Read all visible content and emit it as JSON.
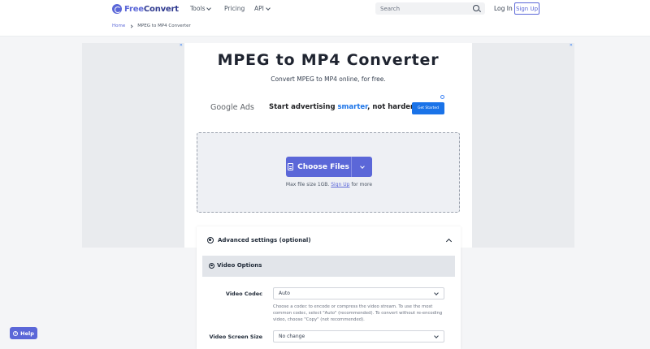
{
  "header": {
    "logo": {
      "part1": "Free",
      "part2": "Convert"
    },
    "nav": [
      {
        "label": "Tools",
        "has_dropdown": true
      },
      {
        "label": "Pricing",
        "has_dropdown": false
      },
      {
        "label": "API",
        "has_dropdown": true
      }
    ],
    "search": {
      "placeholder": "Search",
      "icon": "search-icon"
    },
    "login_label": "Log In",
    "signup_label": "Sign Up"
  },
  "breadcrumb": {
    "home": "Home",
    "current": "MPEG to MP4 Converter"
  },
  "main": {
    "title": "MPEG to MP4 Converter",
    "subtitle": "Convert MPEG to MP4 online, for free."
  },
  "ad": {
    "brand": "Google Ads",
    "tagline_pre": "Start advertising ",
    "tagline_highlight": "smarter",
    "tagline_post": ", not harder.",
    "cta": "Get Started"
  },
  "upload": {
    "button_label": "Choose Files",
    "max_pre": "Max file size 1GB.",
    "max_link": "Sign Up",
    "max_post": "for more"
  },
  "advanced": {
    "title": "Advanced settings (optional)",
    "section_title": "Video Options",
    "fields": [
      {
        "label": "Video Codec",
        "value": "Auto",
        "help": "Choose a codec to encode or compress the video stream. To use the most common codec, select \"Auto\" (recommended). To convert without re-encoding video, choose \"Copy\" (not recommended)."
      },
      {
        "label": "Video Screen Size",
        "value": "No change"
      }
    ]
  },
  "help_label": "Help",
  "colors": {
    "accent": "#5b67d8",
    "ad_blue": "#1a73e8"
  }
}
